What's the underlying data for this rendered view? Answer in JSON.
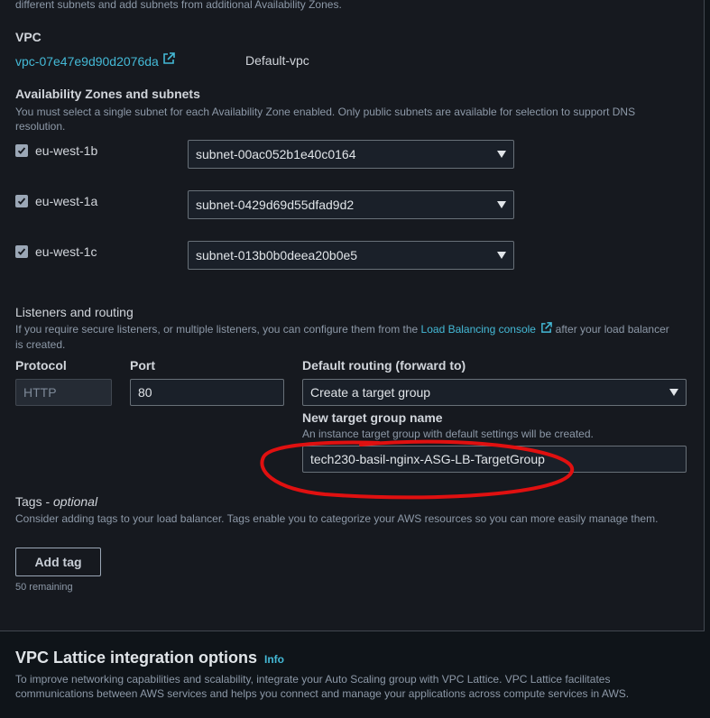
{
  "top_desc": "different subnets and add subnets from additional Availability Zones.",
  "vpc": {
    "label": "VPC",
    "id": "vpc-07e47e9d90d2076da",
    "name": "Default-vpc"
  },
  "az": {
    "label": "Availability Zones and subnets",
    "desc_line1": "You must select a single subnet for each Availability Zone enabled. Only public subnets are available for selection to support DNS",
    "desc_line2": "resolution.",
    "rows": [
      {
        "zone": "eu-west-1b",
        "subnet": "subnet-00ac052b1e40c0164"
      },
      {
        "zone": "eu-west-1a",
        "subnet": "subnet-0429d69d55dfad9d2"
      },
      {
        "zone": "eu-west-1c",
        "subnet": "subnet-013b0b0deea20b0e5"
      }
    ]
  },
  "listeners": {
    "label": "Listeners and routing",
    "desc_pre": "If you require secure listeners, or multiple listeners, you can configure them from the",
    "desc_link": "Load Balancing console",
    "desc_post": "after your load balancer",
    "desc_line2": "is created.",
    "protocol_label": "Protocol",
    "protocol_value": "HTTP",
    "port_label": "Port",
    "port_value": "80",
    "routing_label": "Default routing (forward to)",
    "routing_value": "Create a target group",
    "tg_name_label": "New target group name",
    "tg_name_desc": "An instance target group with default settings will be created.",
    "tg_name_value": "tech230-basil-nginx-ASG-LB-TargetGroup"
  },
  "tags": {
    "label": "Tags - ",
    "label_optional": "optional",
    "desc": "Consider adding tags to your load balancer. Tags enable you to categorize your AWS resources so you can more easily manage them.",
    "add_button": "Add tag",
    "remaining": "50 remaining"
  },
  "lattice": {
    "title": "VPC Lattice integration options",
    "info": "Info",
    "desc_line1": "To improve networking capabilities and scalability, integrate your Auto Scaling group with VPC Lattice. VPC Lattice facilitates",
    "desc_line2": "communications between AWS services and helps you connect and manage your applications across compute services in AWS."
  },
  "colors": {
    "accent_link": "#44b9d6",
    "annotation_red": "#e01010",
    "panel_bg": "#16191f"
  },
  "icons": [
    "external-link-icon",
    "checkbox-checked-icon",
    "caret-down-icon"
  ]
}
